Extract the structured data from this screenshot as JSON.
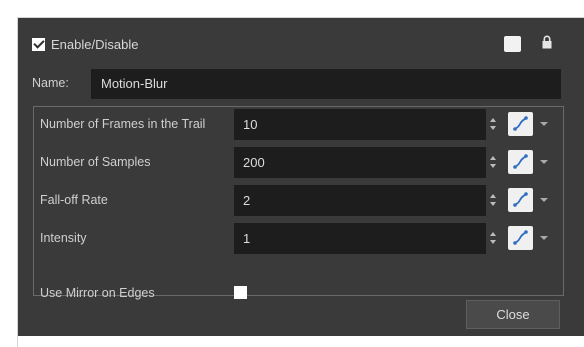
{
  "header": {
    "enable_label": "Enable/Disable",
    "enabled": true
  },
  "name": {
    "label": "Name:",
    "value": "Motion-Blur"
  },
  "params": [
    {
      "label": "Number of Frames in the Trail",
      "value": "10"
    },
    {
      "label": "Number of Samples",
      "value": "200"
    },
    {
      "label": "Fall-off Rate",
      "value": "2"
    },
    {
      "label": "Intensity",
      "value": "1"
    }
  ],
  "mirror": {
    "label": "Use Mirror on Edges",
    "checked": false
  },
  "footer": {
    "close_label": "Close"
  },
  "icons": {
    "enable": "checkbox-checked-icon",
    "swatch": "color-swatch-icon",
    "lock": "lock-icon",
    "function": "function-curve-icon",
    "spinner": "spinner-icon",
    "dropdown": "chevron-down-icon"
  },
  "colors": {
    "dialog_bg": "#3a3a3a",
    "field_bg": "#1d1d1d",
    "text": "#d6d6d6",
    "function_curve": "#2f6ec2"
  }
}
